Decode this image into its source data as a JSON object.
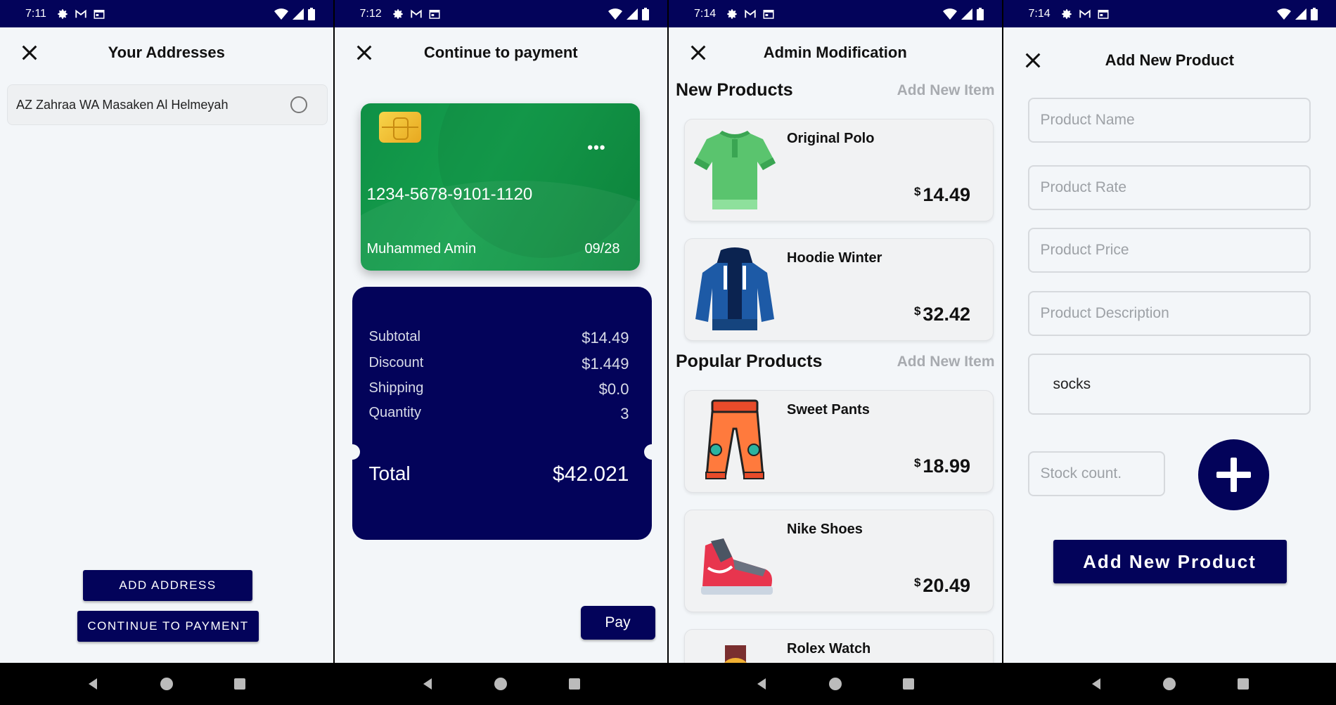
{
  "screens": [
    {
      "status_time": "7:11",
      "title": "Your Addresses",
      "address": "AZ Zahraa WA Masaken Al Helmeyah",
      "add_address_label": "ADD ADDRESS",
      "continue_label": "CONTINUE TO PAYMENT"
    },
    {
      "status_time": "7:12",
      "title": "Continue to payment",
      "card": {
        "dots": "•••",
        "number": "1234-5678-9101-1120",
        "holder": "Muhammed Amin",
        "expiry": "09/28"
      },
      "summary": [
        {
          "label": "Subtotal",
          "value": "$14.49"
        },
        {
          "label": "Discount",
          "value": "$1.449"
        },
        {
          "label": "Shipping",
          "value": "$0.0"
        },
        {
          "label": "Quantity",
          "value": "3"
        }
      ],
      "total_label": "Total",
      "total_value": "$42.021",
      "pay_label": "Pay"
    },
    {
      "status_time": "7:14",
      "title": "Admin Modification",
      "new_products_title": "New Products",
      "popular_products_title": "Popular Products",
      "add_item_label": "Add New Item",
      "currency": "$",
      "products": [
        {
          "name": "Original Polo",
          "price": "14.49",
          "icon": "polo-shirt-icon"
        },
        {
          "name": "Hoodie Winter",
          "price": "32.42",
          "icon": "hoodie-icon"
        },
        {
          "name": "Sweet Pants",
          "price": "18.99",
          "icon": "pants-icon"
        },
        {
          "name": "Nike Shoes",
          "price": "20.49",
          "icon": "shoe-icon"
        },
        {
          "name": "Rolex Watch",
          "price": "",
          "icon": "watch-icon"
        }
      ]
    },
    {
      "status_time": "7:14",
      "title": "Add New Product",
      "fields": {
        "name_placeholder": "Product Name",
        "rate_placeholder": "Product Rate",
        "price_placeholder": "Product Price",
        "description_placeholder": "Product Description",
        "category_value": "socks",
        "stock_placeholder": "Stock count."
      },
      "submit_label": "Add New Product"
    }
  ],
  "colors": {
    "primary": "#03035a",
    "background": "#f3f6f9",
    "card_green": "#15a04d"
  }
}
